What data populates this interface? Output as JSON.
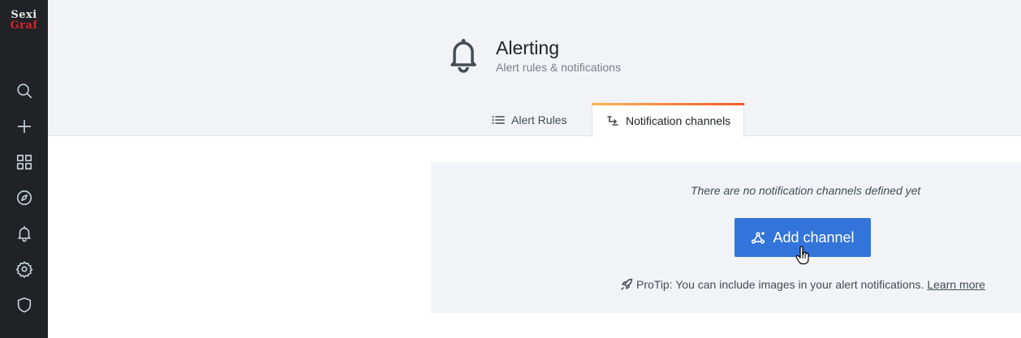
{
  "sidebar": {
    "logo_line1": "Sexi",
    "logo_line2": "Graf",
    "items": [
      {
        "icon": "search-icon",
        "label": "Search"
      },
      {
        "icon": "plus-icon",
        "label": "Create"
      },
      {
        "icon": "dashboards-icon",
        "label": "Dashboards"
      },
      {
        "icon": "compass-icon",
        "label": "Explore"
      },
      {
        "icon": "bell-icon",
        "label": "Alerting"
      },
      {
        "icon": "gear-icon",
        "label": "Configuration"
      },
      {
        "icon": "shield-icon",
        "label": "Server Admin"
      }
    ]
  },
  "header": {
    "icon": "bell-icon",
    "title": "Alerting",
    "subtitle": "Alert rules & notifications"
  },
  "tabs": [
    {
      "label": "Alert Rules",
      "icon": "list-icon",
      "active": false
    },
    {
      "label": "Notification channels",
      "icon": "channel-icon",
      "active": true
    }
  ],
  "empty_state": {
    "message": "There are no notification channels defined yet",
    "button_label": "Add channel",
    "button_icon": "channel-add-icon",
    "protip_text": "ProTip: You can include images in your alert notifications.",
    "protip_link": "Learn more"
  },
  "colors": {
    "sidebar_bg": "#202226",
    "header_bg": "#f1f3f7",
    "primary": "#3274d9",
    "tab_accent_start": "#ffb357",
    "tab_accent_end": "#f05a28"
  }
}
